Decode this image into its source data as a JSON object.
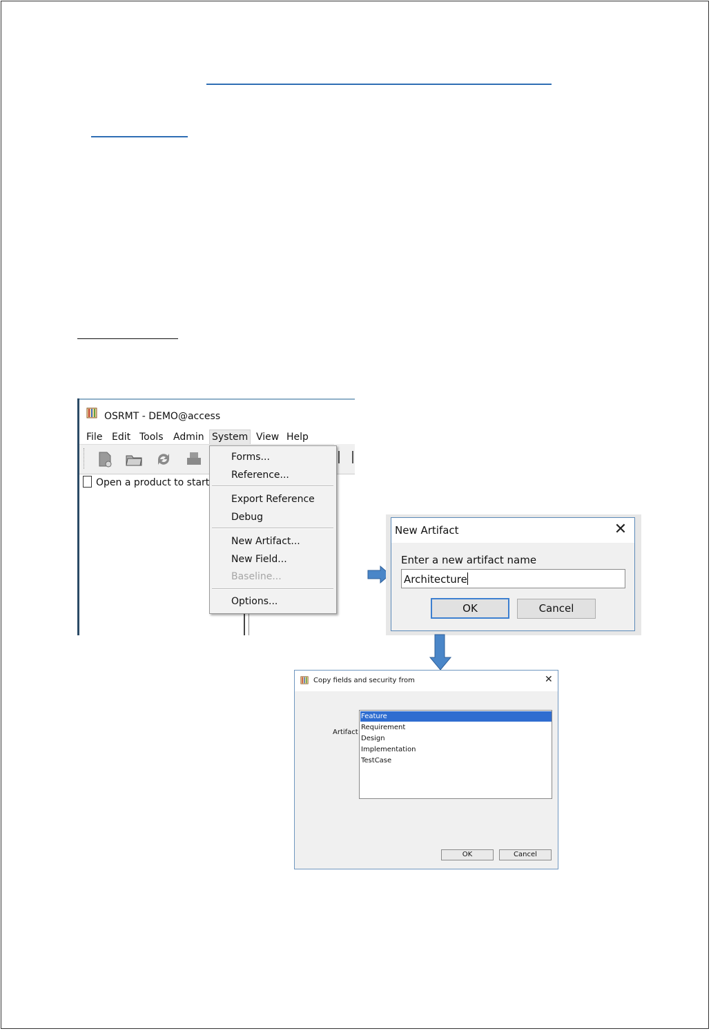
{
  "main_window": {
    "title": "OSRMT - DEMO@access",
    "menus": [
      "File",
      "Edit",
      "Tools",
      "Admin",
      "System",
      "View",
      "Help"
    ],
    "active_menu": "System",
    "tree_item": "Open a product to start",
    "toolbar_icons": [
      "new-product-icon",
      "open-folder-icon",
      "refresh-icon",
      "print-icon"
    ]
  },
  "system_menu": {
    "items": [
      "Forms...",
      "Reference...",
      "Export Reference",
      "Debug",
      "New Artifact...",
      "New Field...",
      "Baseline...",
      "Options..."
    ],
    "disabled": [
      "Baseline..."
    ]
  },
  "new_artifact_dialog": {
    "title": "New Artifact",
    "prompt": "Enter a new artifact name",
    "input_value": "Architecture",
    "ok": "OK",
    "cancel": "Cancel"
  },
  "copy_fields_dialog": {
    "title": "Copy fields and security from",
    "label": "Artifact",
    "options": [
      "Feature",
      "Requirement",
      "Design",
      "Implementation",
      "TestCase"
    ],
    "selected": "Feature",
    "ok": "OK",
    "cancel": "Cancel"
  },
  "colors": {
    "arrow": "#4a86c8",
    "heading_rule": "#2e6db4",
    "selection": "#2f6dd0"
  }
}
